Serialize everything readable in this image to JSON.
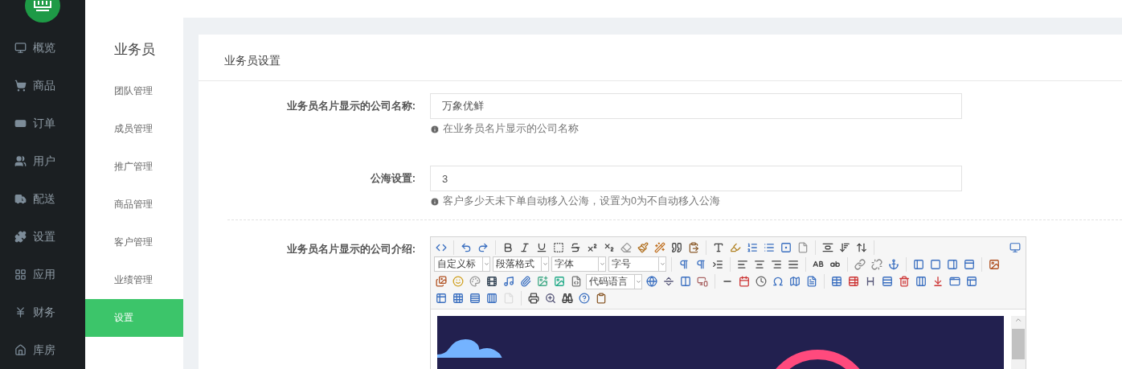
{
  "nav": {
    "items": [
      {
        "label": "概览",
        "selected": false
      },
      {
        "label": "商品",
        "selected": false
      },
      {
        "label": "订单",
        "selected": false
      },
      {
        "label": "用户",
        "selected": false
      },
      {
        "label": "配送",
        "selected": false
      },
      {
        "label": "设置",
        "selected": false
      },
      {
        "label": "应用",
        "selected": false
      },
      {
        "label": "财务",
        "selected": false
      },
      {
        "label": "库房",
        "selected": false
      }
    ]
  },
  "subnav": {
    "title": "业务员",
    "items": [
      {
        "label": "团队管理",
        "selected": false
      },
      {
        "label": "成员管理",
        "selected": false
      },
      {
        "label": "推广管理",
        "selected": false
      },
      {
        "label": "商品管理",
        "selected": false
      },
      {
        "label": "客户管理",
        "selected": false
      },
      {
        "label": "业绩管理",
        "selected": false
      },
      {
        "label": "设置",
        "selected": true
      }
    ]
  },
  "card": {
    "title": "业务员设置"
  },
  "form": {
    "fields": [
      {
        "kind": "text",
        "label": "业务员名片显示的公司名称:",
        "value": "万象优鲜",
        "help": "在业务员名片显示的公司名称"
      },
      {
        "kind": "text",
        "label": "公海设置:",
        "value": "3",
        "help": "客户多少天未下单自动移入公海，设置为0为不自动移入公海"
      },
      {
        "kind": "editor",
        "label": "业务员名片显示的公司介绍:",
        "style_dropdowns": [
          "自定义标",
          "段落格式",
          "字体",
          "字号"
        ],
        "code_dropdown": "代码语言"
      }
    ]
  }
}
